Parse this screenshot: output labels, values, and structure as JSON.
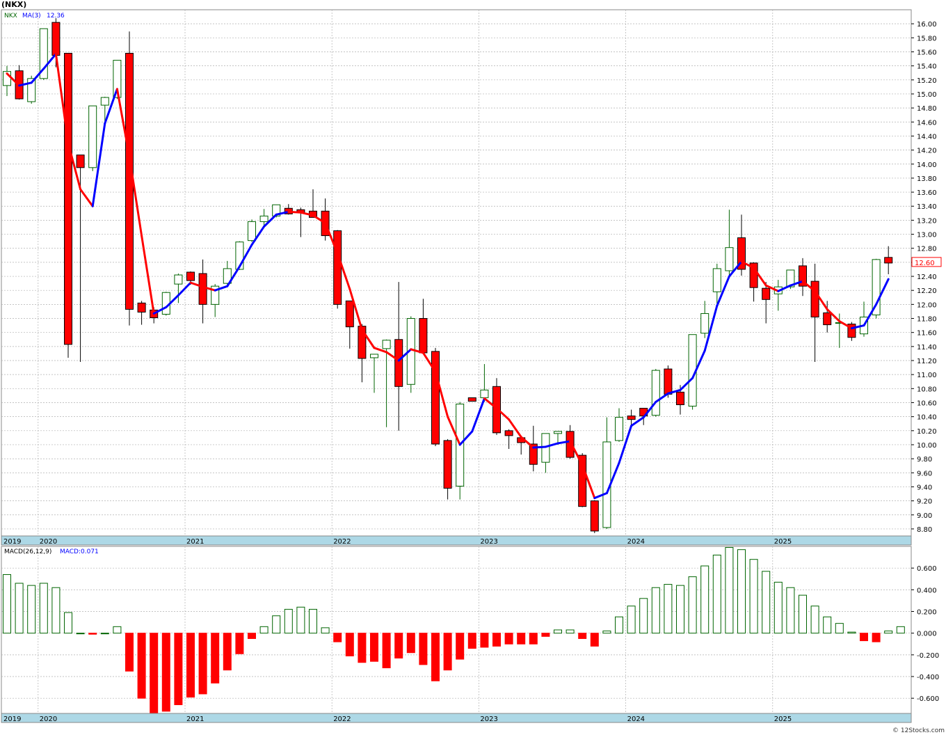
{
  "ticker_label": "(NKX)",
  "legend": {
    "symbol": "NKX",
    "ma_label": "MA(3)",
    "ma_value": "12.36"
  },
  "macd_legend": {
    "label": "MACD(26,12,9)",
    "value_label": "MACD:0.071"
  },
  "last_price": "12.60",
  "watermark": "© 12Stocks.com",
  "colors": {
    "up_candle": "#006400",
    "down_candle": "#ff0000",
    "ma_up": "#0000ff",
    "ma_down": "#ff0000",
    "axis_band": "#add8e6",
    "grid": "#b0b0b0",
    "price_tag": "#ff0000"
  },
  "chart_data": [
    {
      "type": "candlestick",
      "title": "",
      "xlabel": "",
      "ylabel": "",
      "interval": "monthly",
      "ylim": [
        8.7,
        16.2
      ],
      "ytick_labels": [
        "8.80",
        "9.00",
        "9.20",
        "9.40",
        "9.60",
        "9.80",
        "10.00",
        "10.20",
        "10.40",
        "10.60",
        "10.80",
        "11.00",
        "11.20",
        "11.40",
        "11.60",
        "11.80",
        "12.00",
        "12.20",
        "12.40",
        "12.60",
        "12.80",
        "13.00",
        "13.20",
        "13.40",
        "13.60",
        "13.80",
        "14.00",
        "14.20",
        "14.40",
        "14.60",
        "14.80",
        "15.00",
        "15.20",
        "15.40",
        "15.60",
        "15.80",
        "16.00"
      ],
      "year_labels": [
        {
          "label": "2019",
          "month_index": 0
        },
        {
          "label": "2020",
          "month_index": 3
        },
        {
          "label": "2021",
          "month_index": 15
        },
        {
          "label": "2022",
          "month_index": 27
        },
        {
          "label": "2023",
          "month_index": 39
        },
        {
          "label": "2024",
          "month_index": 51
        },
        {
          "label": "2025",
          "month_index": 63
        }
      ],
      "candles": [
        {
          "o": 15.12,
          "h": 15.4,
          "l": 14.97,
          "c": 15.32
        },
        {
          "o": 15.33,
          "h": 15.41,
          "l": 14.92,
          "c": 14.93
        },
        {
          "o": 14.89,
          "h": 15.26,
          "l": 14.86,
          "c": 15.22
        },
        {
          "o": 15.22,
          "h": 15.93,
          "l": 15.2,
          "c": 15.93
        },
        {
          "o": 16.02,
          "h": 16.08,
          "l": 15.38,
          "c": 15.55
        },
        {
          "o": 15.58,
          "h": 15.58,
          "l": 11.24,
          "c": 11.43
        },
        {
          "o": 14.13,
          "h": 14.13,
          "l": 11.18,
          "c": 13.95
        },
        {
          "o": 13.95,
          "h": 14.82,
          "l": 13.9,
          "c": 14.83
        },
        {
          "o": 14.84,
          "h": 14.96,
          "l": 14.53,
          "c": 14.95
        },
        {
          "o": 14.95,
          "h": 15.47,
          "l": 14.93,
          "c": 15.48
        },
        {
          "o": 15.58,
          "h": 15.89,
          "l": 11.7,
          "c": 11.93
        },
        {
          "o": 12.02,
          "h": 12.05,
          "l": 11.71,
          "c": 11.89
        },
        {
          "o": 11.92,
          "h": 11.96,
          "l": 11.73,
          "c": 11.81
        },
        {
          "o": 11.86,
          "h": 12.18,
          "l": 11.84,
          "c": 12.17
        },
        {
          "o": 12.29,
          "h": 12.44,
          "l": 12.02,
          "c": 12.42
        },
        {
          "o": 12.46,
          "h": 12.47,
          "l": 12.28,
          "c": 12.34
        },
        {
          "o": 12.44,
          "h": 12.64,
          "l": 11.73,
          "c": 12.0
        },
        {
          "o": 12.0,
          "h": 12.29,
          "l": 11.82,
          "c": 12.26
        },
        {
          "o": 12.3,
          "h": 12.62,
          "l": 12.26,
          "c": 12.51
        },
        {
          "o": 12.5,
          "h": 12.9,
          "l": 12.49,
          "c": 12.89
        },
        {
          "o": 12.91,
          "h": 13.21,
          "l": 12.89,
          "c": 13.18
        },
        {
          "o": 13.18,
          "h": 13.36,
          "l": 13.11,
          "c": 13.26
        },
        {
          "o": 13.26,
          "h": 13.42,
          "l": 13.24,
          "c": 13.42
        },
        {
          "o": 13.37,
          "h": 13.43,
          "l": 13.28,
          "c": 13.29
        },
        {
          "o": 13.35,
          "h": 13.38,
          "l": 12.96,
          "c": 13.31
        },
        {
          "o": 13.33,
          "h": 13.64,
          "l": 13.24,
          "c": 13.24
        },
        {
          "o": 13.33,
          "h": 13.51,
          "l": 12.91,
          "c": 12.98
        },
        {
          "o": 13.05,
          "h": 13.06,
          "l": 11.94,
          "c": 12.0
        },
        {
          "o": 12.05,
          "h": 12.05,
          "l": 11.37,
          "c": 11.68
        },
        {
          "o": 11.69,
          "h": 11.72,
          "l": 10.89,
          "c": 11.23
        },
        {
          "o": 11.24,
          "h": 11.29,
          "l": 10.74,
          "c": 11.29
        },
        {
          "o": 11.37,
          "h": 11.5,
          "l": 10.25,
          "c": 11.49
        },
        {
          "o": 11.5,
          "h": 12.32,
          "l": 10.2,
          "c": 10.83
        },
        {
          "o": 10.86,
          "h": 11.83,
          "l": 10.74,
          "c": 11.8
        },
        {
          "o": 11.8,
          "h": 12.08,
          "l": 11.29,
          "c": 11.31
        },
        {
          "o": 11.33,
          "h": 11.38,
          "l": 9.98,
          "c": 10.01
        },
        {
          "o": 10.06,
          "h": 10.08,
          "l": 9.22,
          "c": 9.38
        },
        {
          "o": 9.41,
          "h": 10.61,
          "l": 9.22,
          "c": 10.58
        },
        {
          "o": 10.67,
          "h": 10.67,
          "l": 10.62,
          "c": 10.62
        },
        {
          "o": 10.67,
          "h": 11.15,
          "l": 10.61,
          "c": 10.78
        },
        {
          "o": 10.83,
          "h": 10.95,
          "l": 10.14,
          "c": 10.17
        },
        {
          "o": 10.2,
          "h": 10.22,
          "l": 9.94,
          "c": 10.13
        },
        {
          "o": 10.1,
          "h": 10.13,
          "l": 9.86,
          "c": 10.03
        },
        {
          "o": 10.01,
          "h": 10.27,
          "l": 9.62,
          "c": 9.72
        },
        {
          "o": 9.75,
          "h": 10.15,
          "l": 9.6,
          "c": 10.16
        },
        {
          "o": 10.16,
          "h": 10.19,
          "l": 10.0,
          "c": 10.19
        },
        {
          "o": 10.19,
          "h": 10.28,
          "l": 9.8,
          "c": 9.82
        },
        {
          "o": 9.85,
          "h": 9.88,
          "l": 9.11,
          "c": 9.12
        },
        {
          "o": 9.2,
          "h": 9.21,
          "l": 8.74,
          "c": 8.77
        },
        {
          "o": 8.82,
          "h": 10.39,
          "l": 8.8,
          "c": 10.04
        },
        {
          "o": 10.06,
          "h": 10.52,
          "l": 10.04,
          "c": 10.39
        },
        {
          "o": 10.41,
          "h": 10.5,
          "l": 10.28,
          "c": 10.36
        },
        {
          "o": 10.52,
          "h": 10.52,
          "l": 10.28,
          "c": 10.41
        },
        {
          "o": 10.42,
          "h": 11.08,
          "l": 10.4,
          "c": 11.06
        },
        {
          "o": 11.08,
          "h": 11.13,
          "l": 10.67,
          "c": 10.72
        },
        {
          "o": 10.75,
          "h": 10.85,
          "l": 10.43,
          "c": 10.57
        },
        {
          "o": 10.55,
          "h": 11.57,
          "l": 10.5,
          "c": 11.57
        },
        {
          "o": 11.59,
          "h": 12.05,
          "l": 11.52,
          "c": 11.87
        },
        {
          "o": 12.18,
          "h": 12.58,
          "l": 12.01,
          "c": 12.51
        },
        {
          "o": 12.48,
          "h": 13.35,
          "l": 12.4,
          "c": 12.81
        },
        {
          "o": 12.95,
          "h": 13.28,
          "l": 12.41,
          "c": 12.5
        },
        {
          "o": 12.59,
          "h": 12.6,
          "l": 12.04,
          "c": 12.24
        },
        {
          "o": 12.23,
          "h": 12.32,
          "l": 11.73,
          "c": 12.07
        },
        {
          "o": 12.15,
          "h": 12.35,
          "l": 11.91,
          "c": 12.25
        },
        {
          "o": 12.25,
          "h": 12.49,
          "l": 12.22,
          "c": 12.49
        },
        {
          "o": 12.55,
          "h": 12.66,
          "l": 12.12,
          "c": 12.26
        },
        {
          "o": 12.33,
          "h": 12.58,
          "l": 11.18,
          "c": 11.82
        },
        {
          "o": 11.88,
          "h": 12.05,
          "l": 11.6,
          "c": 11.71
        },
        {
          "o": 11.74,
          "h": 11.87,
          "l": 11.38,
          "c": 11.74
        },
        {
          "o": 11.72,
          "h": 11.75,
          "l": 11.48,
          "c": 11.53
        },
        {
          "o": 11.58,
          "h": 12.04,
          "l": 11.54,
          "c": 11.82
        },
        {
          "o": 11.85,
          "h": 12.65,
          "l": 11.8,
          "c": 12.64
        },
        {
          "o": 12.67,
          "h": 12.83,
          "l": 12.43,
          "c": 12.59
        }
      ],
      "ma3": [
        15.29,
        15.12,
        15.16,
        15.36,
        15.57,
        14.3,
        13.64,
        13.4,
        14.58,
        15.07,
        14.11,
        12.98,
        11.87,
        11.96,
        12.13,
        12.31,
        12.25,
        12.2,
        12.26,
        12.54,
        12.85,
        13.11,
        13.28,
        13.32,
        13.31,
        13.27,
        13.16,
        12.73,
        12.22,
        11.64,
        11.38,
        11.32,
        11.2,
        11.36,
        11.31,
        11.04,
        10.4,
        10.0,
        10.19,
        10.66,
        10.52,
        10.36,
        10.11,
        9.96,
        9.97,
        10.02,
        10.05,
        9.71,
        9.24,
        9.31,
        9.74,
        10.27,
        10.39,
        10.61,
        10.73,
        10.78,
        10.95,
        11.34,
        11.98,
        12.4,
        12.61,
        12.52,
        12.27,
        12.19,
        12.27,
        12.33,
        12.19,
        11.93,
        11.76,
        11.66,
        11.7,
        12.0,
        12.36
      ]
    },
    {
      "type": "bar",
      "title": "",
      "xlabel": "",
      "ylabel": "",
      "ylim": [
        -0.74,
        0.8
      ],
      "ytick_labels": [
        "-0.600",
        "-0.400",
        "-0.200",
        "0.000",
        "0.200",
        "0.400",
        "0.600"
      ],
      "values": [
        0.54,
        0.46,
        0.44,
        0.46,
        0.42,
        0.19,
        0.0,
        -0.01,
        0.0,
        0.06,
        -0.35,
        -0.6,
        -0.75,
        -0.72,
        -0.66,
        -0.59,
        -0.56,
        -0.46,
        -0.34,
        -0.19,
        -0.05,
        0.06,
        0.16,
        0.22,
        0.24,
        0.22,
        0.05,
        -0.08,
        -0.21,
        -0.27,
        -0.26,
        -0.32,
        -0.23,
        -0.18,
        -0.29,
        -0.44,
        -0.34,
        -0.24,
        -0.14,
        -0.13,
        -0.12,
        -0.1,
        -0.1,
        -0.1,
        -0.03,
        0.03,
        0.03,
        -0.05,
        -0.12,
        0.02,
        0.15,
        0.25,
        0.32,
        0.42,
        0.45,
        0.44,
        0.52,
        0.62,
        0.72,
        0.79,
        0.77,
        0.68,
        0.57,
        0.47,
        0.42,
        0.35,
        0.25,
        0.15,
        0.09,
        0.01,
        -0.07,
        -0.08,
        0.02,
        0.06
      ]
    }
  ]
}
